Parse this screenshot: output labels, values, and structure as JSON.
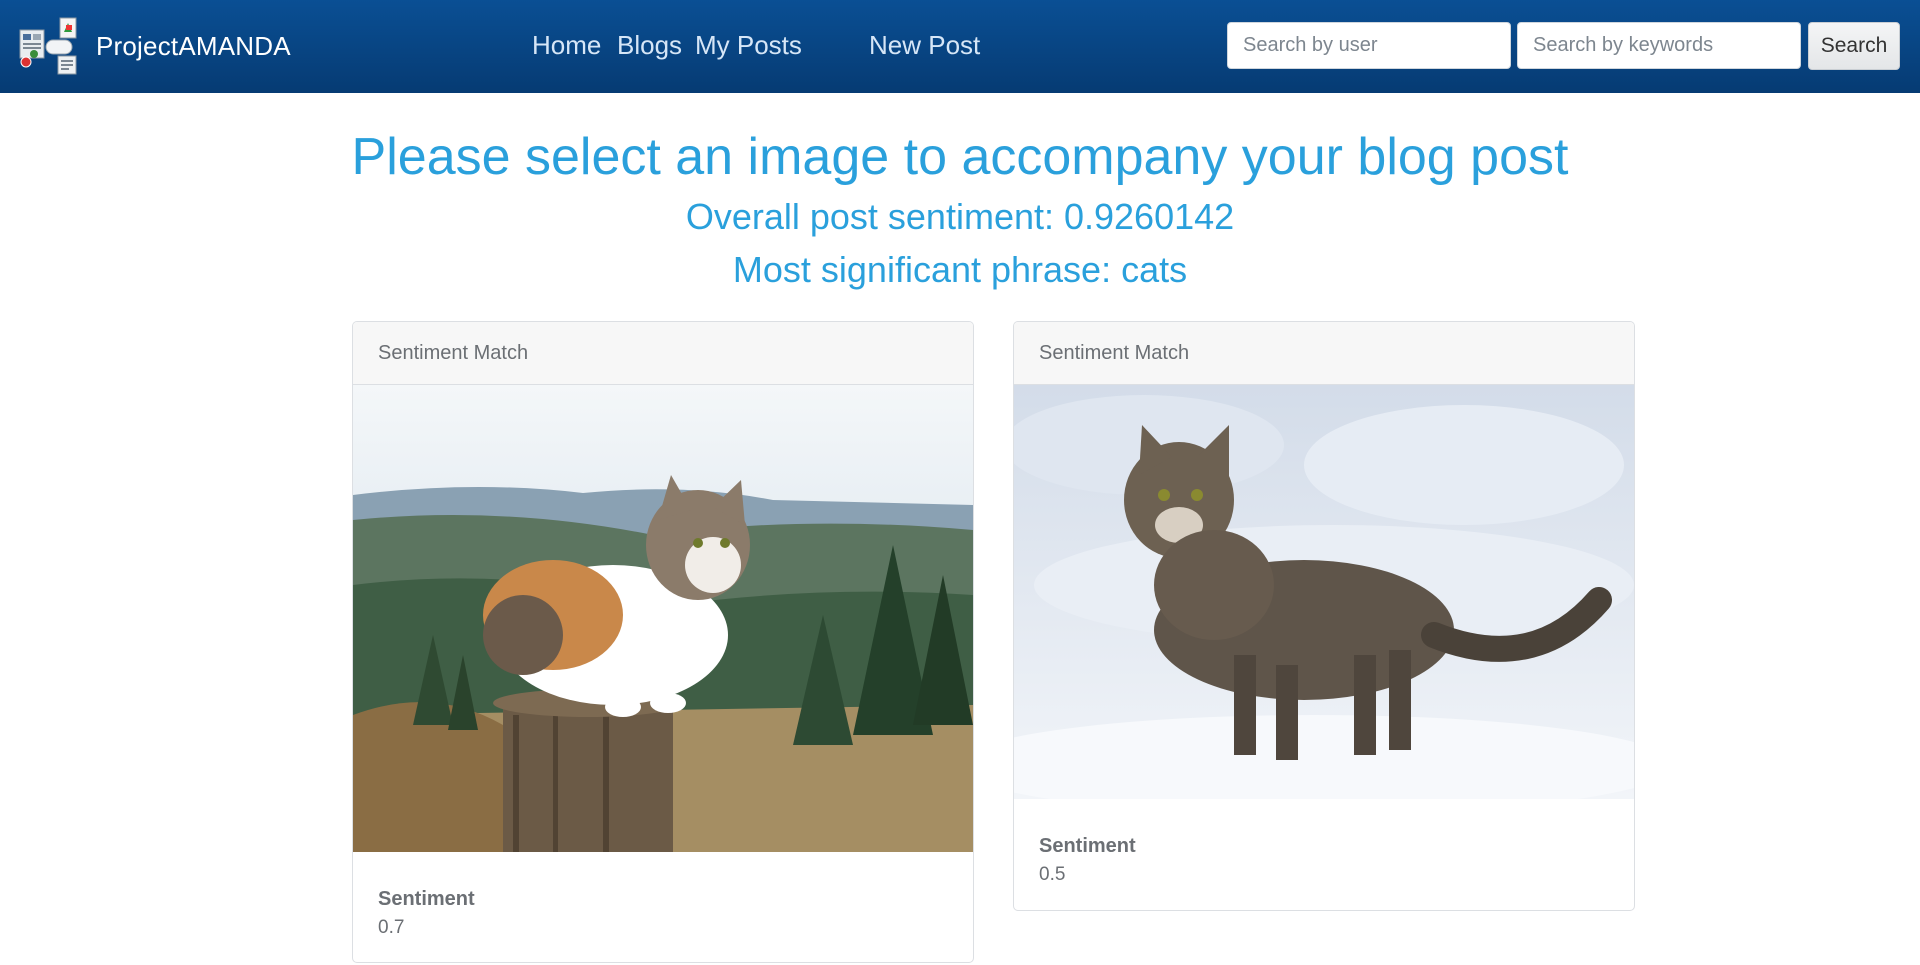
{
  "colors": {
    "navbar": "#063b73",
    "nav_link": "#d6e6f7",
    "heading": "#2aa0dc",
    "card_text": "#6b6f74"
  },
  "navbar": {
    "brand": "ProjectAMANDA",
    "links": [
      {
        "label": "Home"
      },
      {
        "label": "Blogs"
      },
      {
        "label": "My Posts"
      },
      {
        "label": "New Post"
      }
    ],
    "search_user_placeholder": "Search by user",
    "search_keywords_placeholder": "Search by keywords",
    "search_button": "Search"
  },
  "main": {
    "title": "Please select an image to accompany your blog post",
    "sentiment_line": "Overall post sentiment: 0.9260142",
    "phrase_line": "Most significant phrase: cats"
  },
  "cards": [
    {
      "header": "Sentiment Match",
      "image_icon": "calico-cat-on-post-photo",
      "sentiment_label": "Sentiment",
      "sentiment_value": "0.7"
    },
    {
      "header": "Sentiment Match",
      "image_icon": "tabby-cat-in-snow-photo",
      "sentiment_label": "Sentiment",
      "sentiment_value": "0.5"
    }
  ]
}
